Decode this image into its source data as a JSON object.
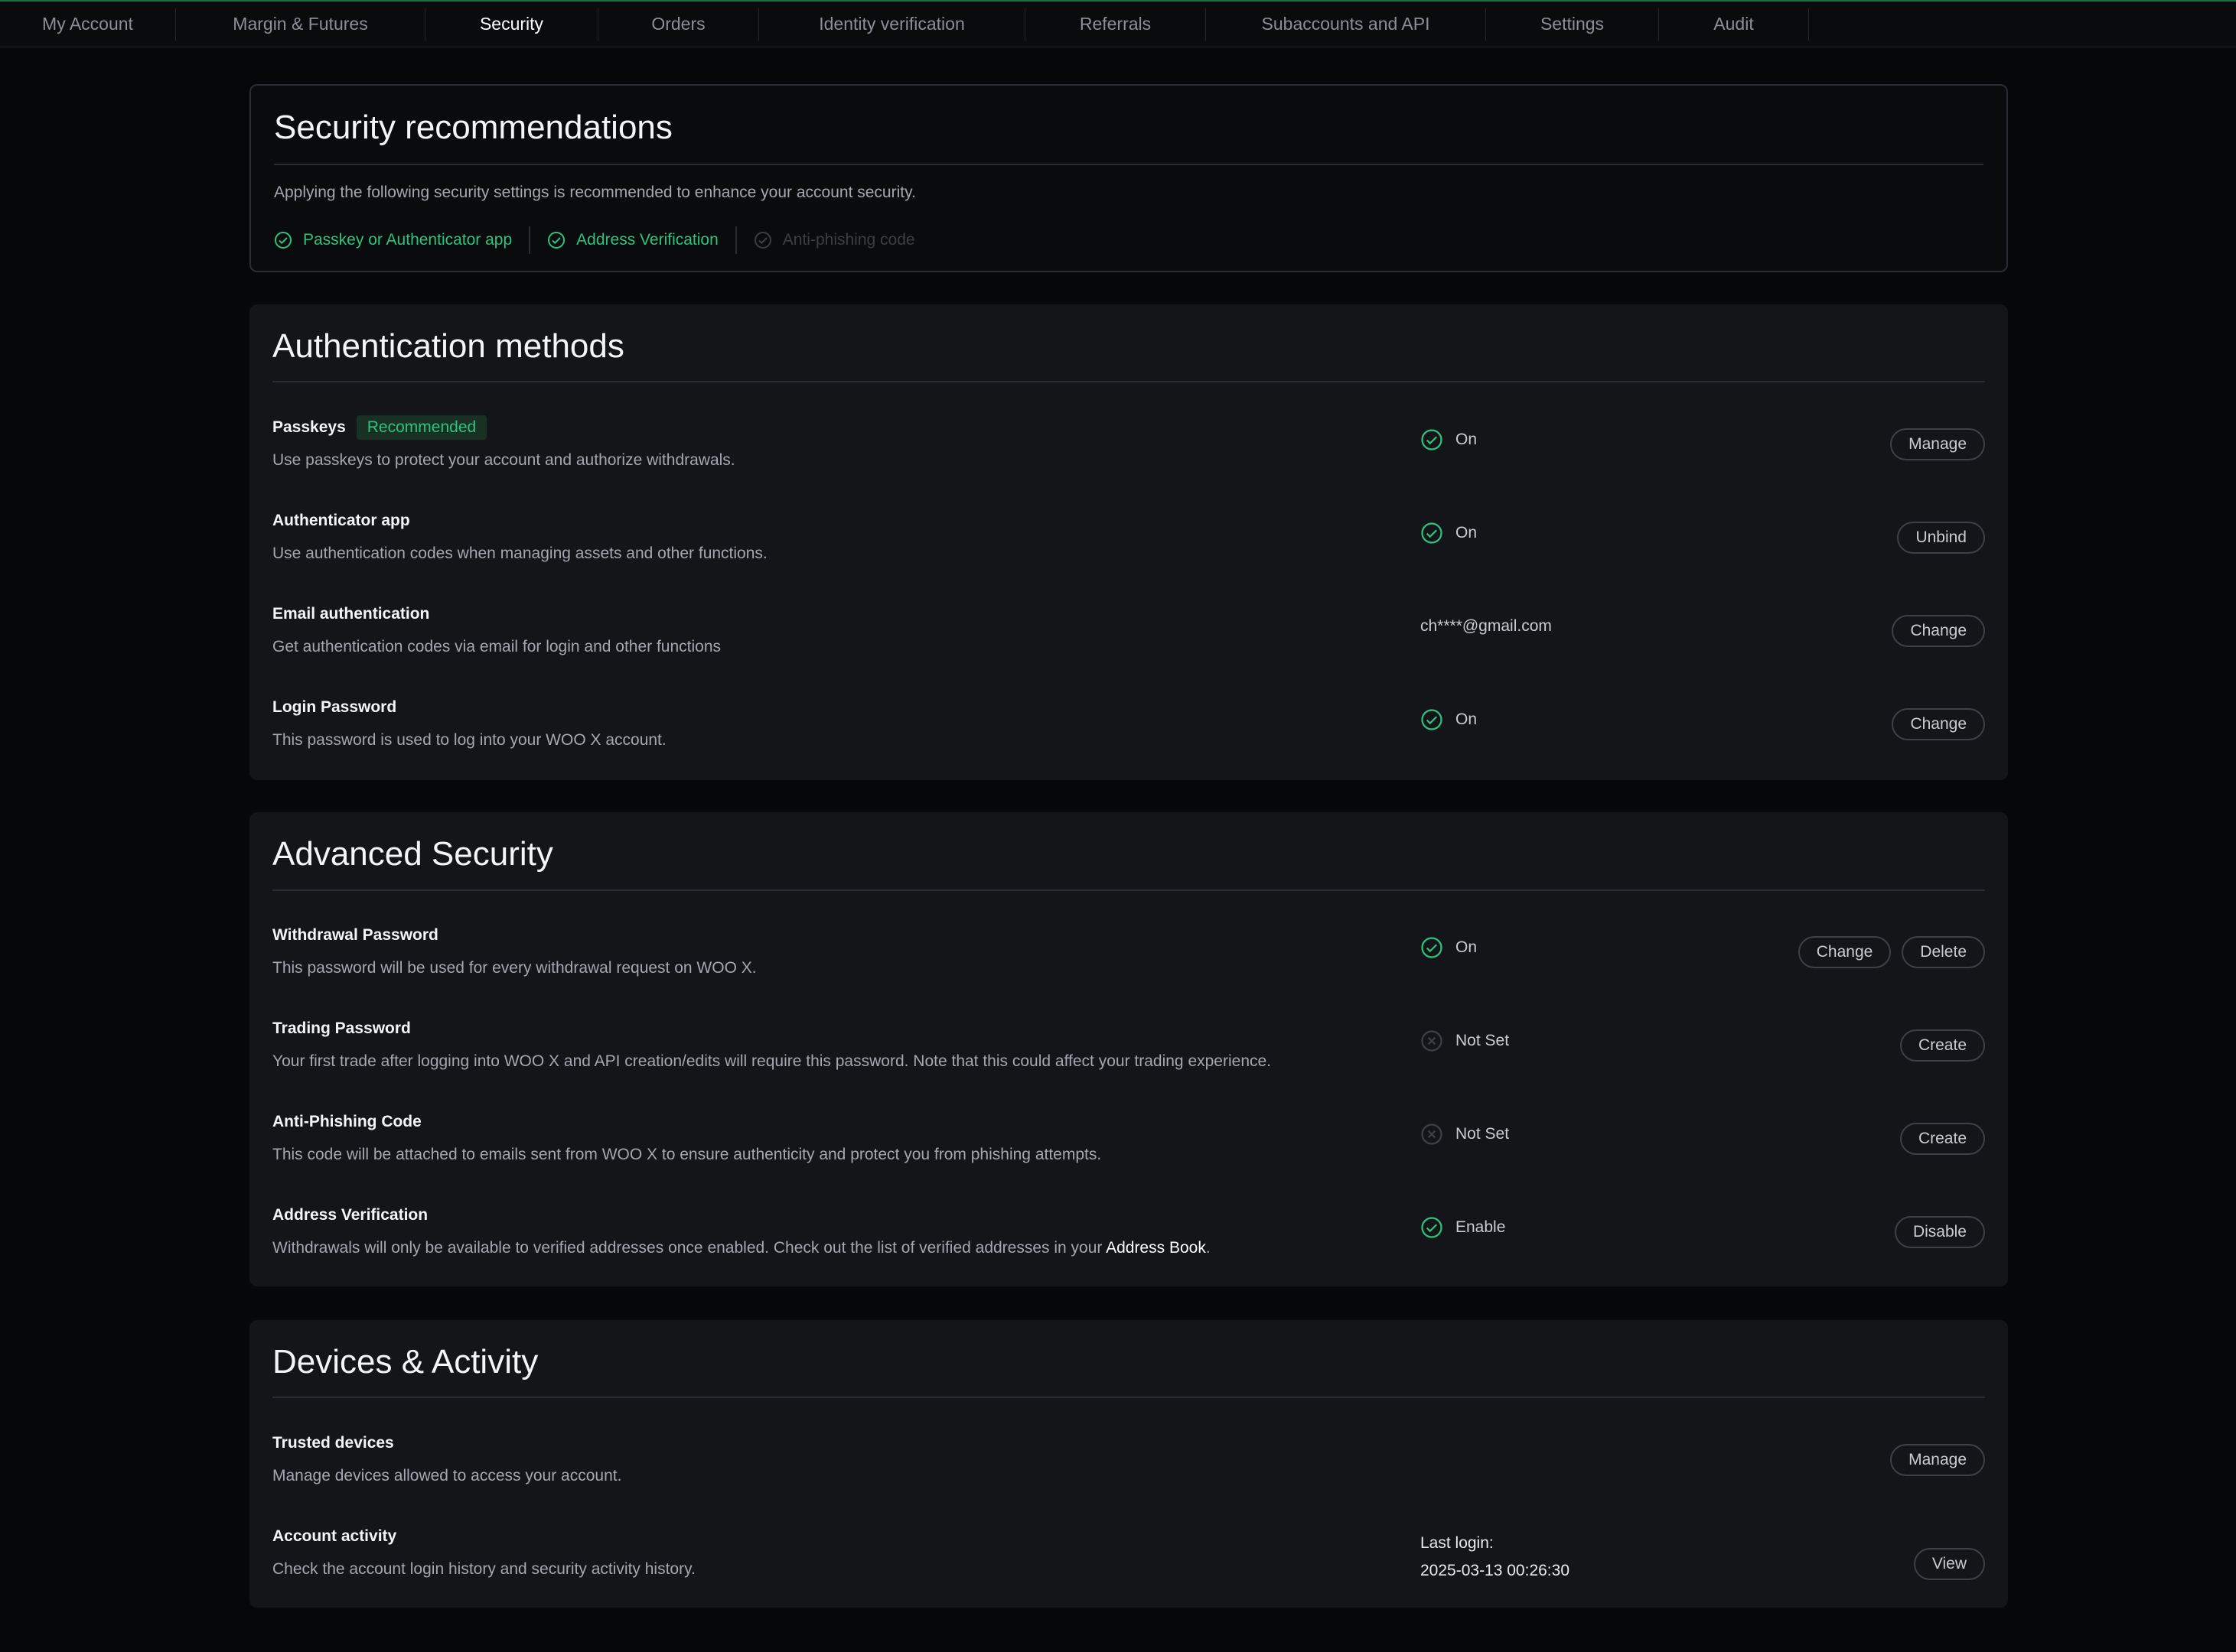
{
  "tabs": [
    {
      "label": "My Account"
    },
    {
      "label": "Margin & Futures"
    },
    {
      "label": "Security"
    },
    {
      "label": "Orders"
    },
    {
      "label": "Identity verification"
    },
    {
      "label": "Referrals"
    },
    {
      "label": "Subaccounts and API"
    },
    {
      "label": "Settings"
    },
    {
      "label": "Audit"
    }
  ],
  "active_tab": "Security",
  "recommendations": {
    "title": "Security recommendations",
    "text": "Applying the following security settings is recommended to enhance your account security.",
    "items": [
      {
        "label": "Passkey or Authenticator app",
        "done": true
      },
      {
        "label": "Address Verification",
        "done": true
      },
      {
        "label": "Anti-phishing code",
        "done": false
      }
    ]
  },
  "auth": {
    "title": "Authentication methods",
    "rows": [
      {
        "title": "Passkeys",
        "badge": "Recommended",
        "desc": "Use passkeys to protect your account and authorize withdrawals.",
        "status": "On",
        "buttons": [
          "Manage"
        ]
      },
      {
        "title": "Authenticator app",
        "desc": "Use authentication codes when managing assets and other functions.",
        "status": "On",
        "buttons": [
          "Unbind"
        ]
      },
      {
        "title": "Email authentication",
        "desc": "Get authentication codes via email for login and other functions",
        "value": "ch****@gmail.com",
        "buttons": [
          "Change"
        ]
      },
      {
        "title": "Login Password",
        "desc": "This password is used to log into your WOO X account.",
        "status": "On",
        "buttons": [
          "Change"
        ]
      }
    ]
  },
  "advanced": {
    "title": "Advanced Security",
    "rows": [
      {
        "title": "Withdrawal Password",
        "desc": "This password will be used for every withdrawal request on WOO X.",
        "status": "On",
        "buttons": [
          "Change",
          "Delete"
        ]
      },
      {
        "title": "Trading Password",
        "desc": "Your first trade after logging into WOO X and API creation/edits will require this password. Note that this could affect your trading experience.",
        "status": "Not Set",
        "buttons": [
          "Create"
        ]
      },
      {
        "title": "Anti-Phishing Code",
        "desc": "This code will be attached to emails sent from WOO X to ensure authenticity and protect you from phishing attempts.",
        "status": "Not Set",
        "buttons": [
          "Create"
        ]
      },
      {
        "title": "Address Verification",
        "desc": "Withdrawals will only be available to verified addresses once enabled. Check out the list of verified addresses in your ",
        "desc_link": "Address Book",
        "desc_end": ".",
        "status": "Enable",
        "buttons": [
          "Disable"
        ]
      }
    ]
  },
  "devices": {
    "title": "Devices & Activity",
    "rows": [
      {
        "title": "Trusted devices",
        "desc": "Manage devices allowed to access your account.",
        "buttons": [
          "Manage"
        ]
      },
      {
        "title": "Account activity",
        "desc": "Check the account login history and security activity history.",
        "last_login_label": "Last login:",
        "last_login": "2025-03-13 00:26:30",
        "buttons": [
          "View"
        ]
      }
    ]
  },
  "colors": {
    "accent": "#2ec27e",
    "background": "#060708",
    "card": "#141519",
    "muted": "#a3a8b0"
  }
}
